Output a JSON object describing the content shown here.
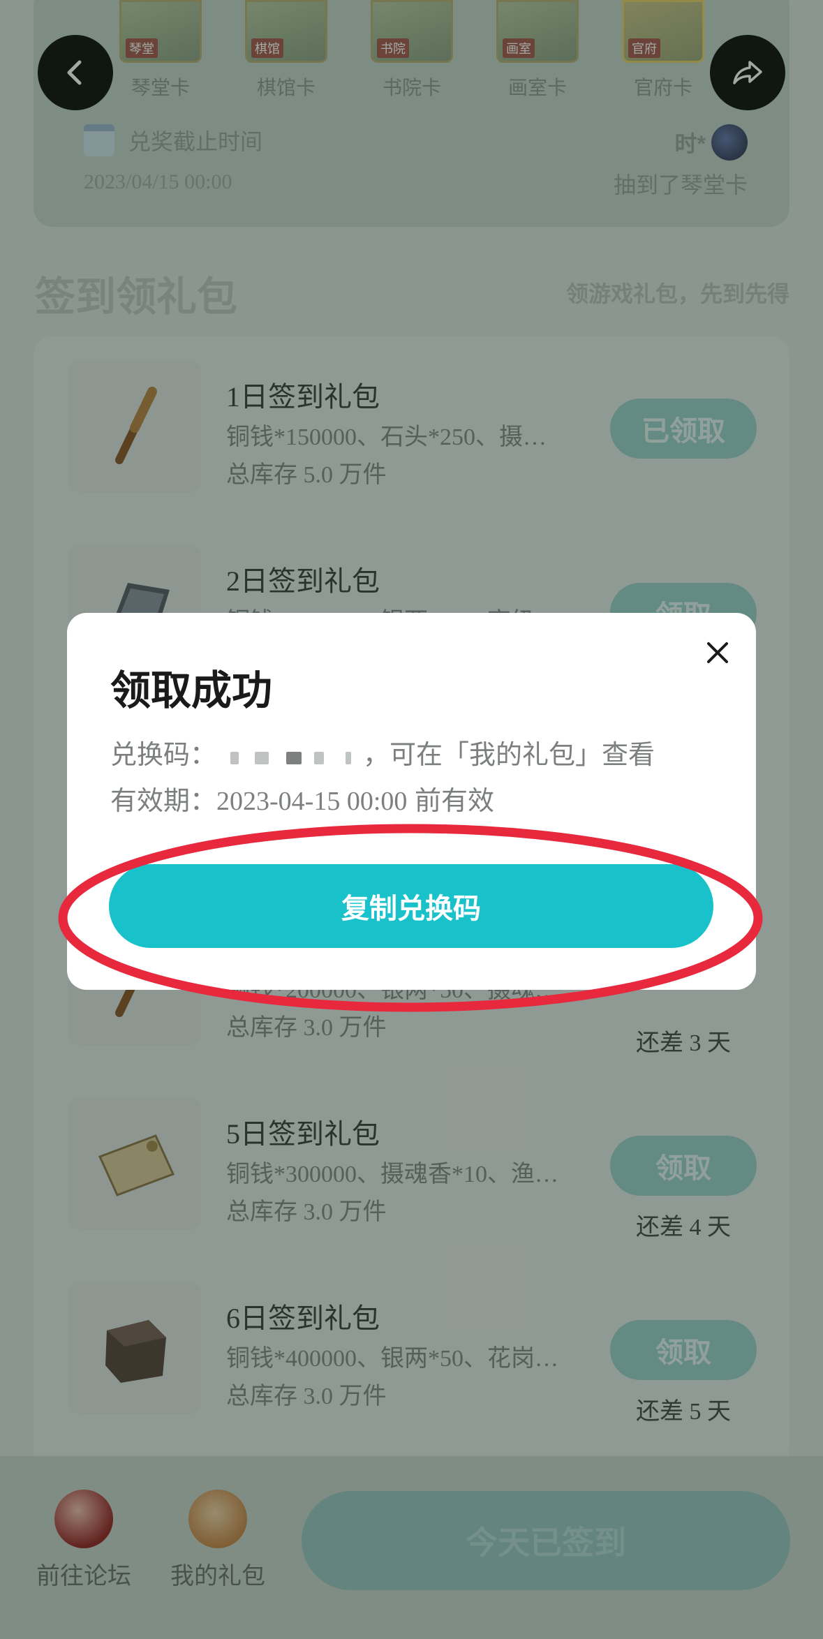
{
  "top": {
    "cards": [
      {
        "tag": "琴堂",
        "label": "琴堂卡"
      },
      {
        "tag": "棋馆",
        "label": "棋馆卡"
      },
      {
        "tag": "书院",
        "label": "书院卡"
      },
      {
        "tag": "画室",
        "label": "画室卡"
      },
      {
        "tag": "官府",
        "label": "官府卡"
      }
    ],
    "deadline_title": "兑奖截止时间",
    "deadline_date": "2023/04/15 00:00",
    "winner_name": "时*",
    "winner_text": "抽到了琴堂卡"
  },
  "section": {
    "title": "签到领礼包",
    "subtitle": "领游戏礼包，先到先得"
  },
  "gifts": [
    {
      "title": "1日签到礼包",
      "items": "铜钱*150000、石头*250、摄…",
      "stock": "总库存 5.0 万件",
      "button": "已领取",
      "remain": ""
    },
    {
      "title": "2日签到礼包",
      "items": "铜钱*200000、银两*50、高级…",
      "stock": "",
      "button": "领取",
      "remain": ""
    },
    {
      "title": "",
      "items": "铜钱*200000、银两*50、摄魂…",
      "stock": "总库存 3.0 万件",
      "button": "",
      "remain": "还差 3 天"
    },
    {
      "title": "5日签到礼包",
      "items": "铜钱*300000、摄魂香*10、渔…",
      "stock": "总库存 3.0 万件",
      "button": "领取",
      "remain": "还差 4 天"
    },
    {
      "title": "6日签到礼包",
      "items": "铜钱*400000、银两*50、花岗…",
      "stock": "总库存 3.0 万件",
      "button": "领取",
      "remain": "还差 5 天"
    }
  ],
  "bottom": {
    "forum_label": "前往论坛",
    "my_gifts_label": "我的礼包",
    "signed_label": "今天已签到"
  },
  "modal": {
    "title": "领取成功",
    "code_label": "兑换码：",
    "code_suffix": "，可在「我的礼包」查看",
    "validity_label": "有效期：",
    "validity_value": "2023-04-15 00:00",
    "validity_suffix": " 前有效",
    "copy_button": "复制兑换码"
  },
  "colors": {
    "accent": "#19c2cb",
    "highlight": "#e8283c"
  }
}
